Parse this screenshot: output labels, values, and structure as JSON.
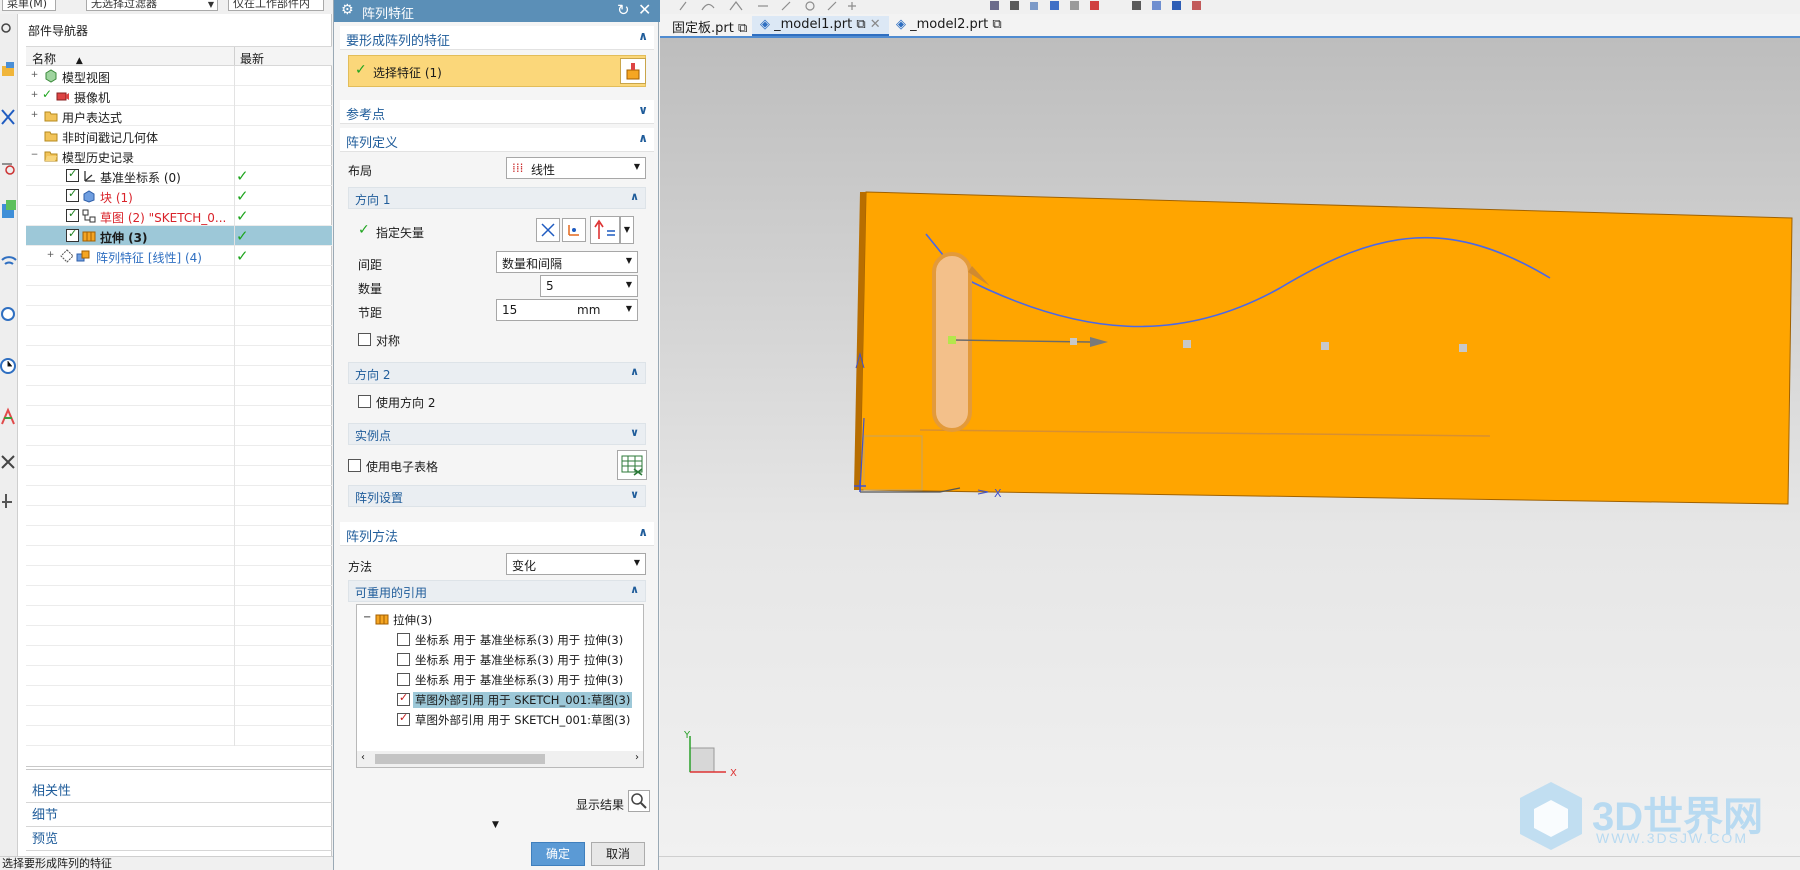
{
  "toolbar": {
    "menu_label": "菜单(M)",
    "filter_value": "无选择过滤器",
    "scope_value": "仅在工作部件内"
  },
  "navigator": {
    "title": "部件导航器",
    "col_name": "名称",
    "col_latest": "最新",
    "rows": [
      {
        "label": "模型视图",
        "color": "#1a1a1a"
      },
      {
        "label": "摄像机",
        "color": "#1a1a1a"
      },
      {
        "label": "用户表达式",
        "color": "#1a1a1a"
      },
      {
        "label": "非时间戳记几何体",
        "color": "#1a1a1a"
      },
      {
        "label": "模型历史记录",
        "color": "#1a1a1a"
      },
      {
        "label": "基准坐标系 (0)",
        "color": "#1a1a1a"
      },
      {
        "label": "块 (1)",
        "color": "#d9232a"
      },
      {
        "label": "草图 (2) \"SKETCH_0...",
        "color": "#d9232a"
      },
      {
        "label": "拉伸 (3)",
        "color": "#1a1a1a"
      },
      {
        "label": "阵列特征 [线性] (4)",
        "color": "#2f6fc1"
      }
    ],
    "bottom": [
      "相关性",
      "细节",
      "预览"
    ]
  },
  "status_text": "选择要形成阵列的特征",
  "dialog": {
    "title": "阵列特征",
    "sec_features": "要形成阵列的特征",
    "select_feature": "选择特征 (1)",
    "sec_refpoint": "参考点",
    "sec_arraydef": "阵列定义",
    "layout_label": "布局",
    "layout_value": "线性",
    "dir1": "方向 1",
    "specify_vector": "指定矢量",
    "spacing_label": "间距",
    "spacing_value": "数量和间隔",
    "count_label": "数量",
    "count_value": "5",
    "pitch_label": "节距",
    "pitch_value": "15",
    "pitch_unit": "mm",
    "symmetric": "对称",
    "dir2": "方向 2",
    "use_dir2": "使用方向 2",
    "instance_pts": "实例点",
    "use_spreadsheet": "使用电子表格",
    "array_settings": "阵列设置",
    "sec_method": "阵列方法",
    "method_label": "方法",
    "method_value": "变化",
    "reusable_refs": "可重用的引用",
    "ref_root": "拉伸(3)",
    "refs": [
      {
        "text": "坐标系 用于 基准坐标系(3) 用于 拉伸(3)",
        "checked": false
      },
      {
        "text": "坐标系 用于 基准坐标系(3) 用于 拉伸(3)",
        "checked": false
      },
      {
        "text": "坐标系 用于 基准坐标系(3) 用于 拉伸(3)",
        "checked": false
      },
      {
        "text": "草图外部引用 用于 SKETCH_001:草图(3)",
        "checked": true
      },
      {
        "text": "草图外部引用 用于 SKETCH_001:草图(3)",
        "checked": true
      }
    ],
    "show_result": "显示结果",
    "ok": "确定",
    "cancel": "取消"
  },
  "tabs": [
    "固定板.prt",
    "_model1.prt",
    "_model2.prt"
  ],
  "axis_x": "X",
  "axis_y": "Y",
  "watermark": {
    "title": "3D世界网",
    "url": "WWW.3DSJW.COM"
  },
  "colors": {
    "dialog_title": "#5b8fb7",
    "link": "#1f5c9a",
    "part": "#ffa500",
    "selection": "#fbd77a",
    "curve": "#4a68e8"
  }
}
